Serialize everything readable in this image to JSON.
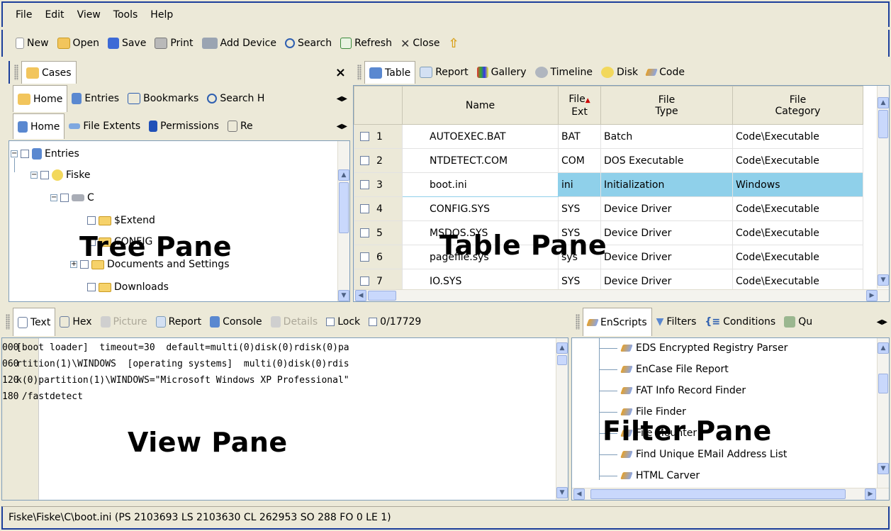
{
  "menu": [
    "File",
    "Edit",
    "View",
    "Tools",
    "Help"
  ],
  "toolbar": {
    "new": "New",
    "open": "Open",
    "save": "Save",
    "print": "Print",
    "add_device": "Add Device",
    "search": "Search",
    "refresh": "Refresh",
    "close": "Close"
  },
  "tree_pane": {
    "header": "Cases",
    "close": "×",
    "tabs": [
      "Home",
      "Entries",
      "Bookmarks",
      "Search H"
    ],
    "subtabs": [
      "Home",
      "File Extents",
      "Permissions",
      "Re"
    ],
    "nodes": [
      "Entries",
      "Fiske",
      "C",
      "$Extend",
      "CONFIG",
      "Documents and Settings",
      "Downloads"
    ],
    "label": "Tree Pane"
  },
  "table_pane": {
    "tabs": [
      "Table",
      "Report",
      "Gallery",
      "Timeline",
      "Disk",
      "Code"
    ],
    "columns": {
      "name": "Name",
      "ext1": "File",
      "ext2": "Ext",
      "type1": "File",
      "type2": "Type",
      "cat1": "File",
      "cat2": "Category"
    },
    "rows": [
      {
        "no": "1",
        "name": "AUTOEXEC.BAT",
        "ext": "BAT",
        "type": "Batch",
        "category": "Code\\Executable"
      },
      {
        "no": "2",
        "name": "NTDETECT.COM",
        "ext": "COM",
        "type": "DOS Executable",
        "category": "Code\\Executable"
      },
      {
        "no": "3",
        "name": "boot.ini",
        "ext": "ini",
        "type": "Initialization",
        "category": "Windows"
      },
      {
        "no": "4",
        "name": "CONFIG.SYS",
        "ext": "SYS",
        "type": "Device Driver",
        "category": "Code\\Executable"
      },
      {
        "no": "5",
        "name": "MSDOS.SYS",
        "ext": "SYS",
        "type": "Device Driver",
        "category": "Code\\Executable"
      },
      {
        "no": "6",
        "name": "pagefile.sys",
        "ext": "sys",
        "type": "Device Driver",
        "category": "Code\\Executable"
      },
      {
        "no": "7",
        "name": "IO.SYS",
        "ext": "SYS",
        "type": "Device Driver",
        "category": "Code\\Executable"
      }
    ],
    "label": "Table Pane"
  },
  "view_pane": {
    "tabs": [
      "Text",
      "Hex",
      "Picture",
      "Report",
      "Console",
      "Details",
      "Lock"
    ],
    "counter": "0/17729",
    "lines": [
      {
        "offset": "000",
        "text": "[boot loader]  timeout=30  default=multi(0)disk(0)rdisk(0)pa"
      },
      {
        "offset": "060",
        "text": "rtition(1)\\WINDOWS  [operating systems]  multi(0)disk(0)rdis"
      },
      {
        "offset": "120",
        "text": "k(0)partition(1)\\WINDOWS=\"Microsoft Windows XP Professional\""
      },
      {
        "offset": "180",
        "text": " /fastdetect"
      }
    ],
    "label": "View Pane"
  },
  "filter_pane": {
    "tabs": [
      "EnScripts",
      "Filters",
      "Conditions",
      "Qu"
    ],
    "items": [
      "EDS Encrypted Registry Parser",
      "EnCase File Report",
      "FAT Info Record Finder",
      "File Finder",
      "File Mounter",
      "Find Unique EMail Address List",
      "HTML Carver"
    ],
    "label": "Filter Pane"
  },
  "status": "Fiske\\Fiske\\C\\boot.ini (PS 2103693  LS 2103630  CL 262953  SO 288  FO 0  LE 1)"
}
